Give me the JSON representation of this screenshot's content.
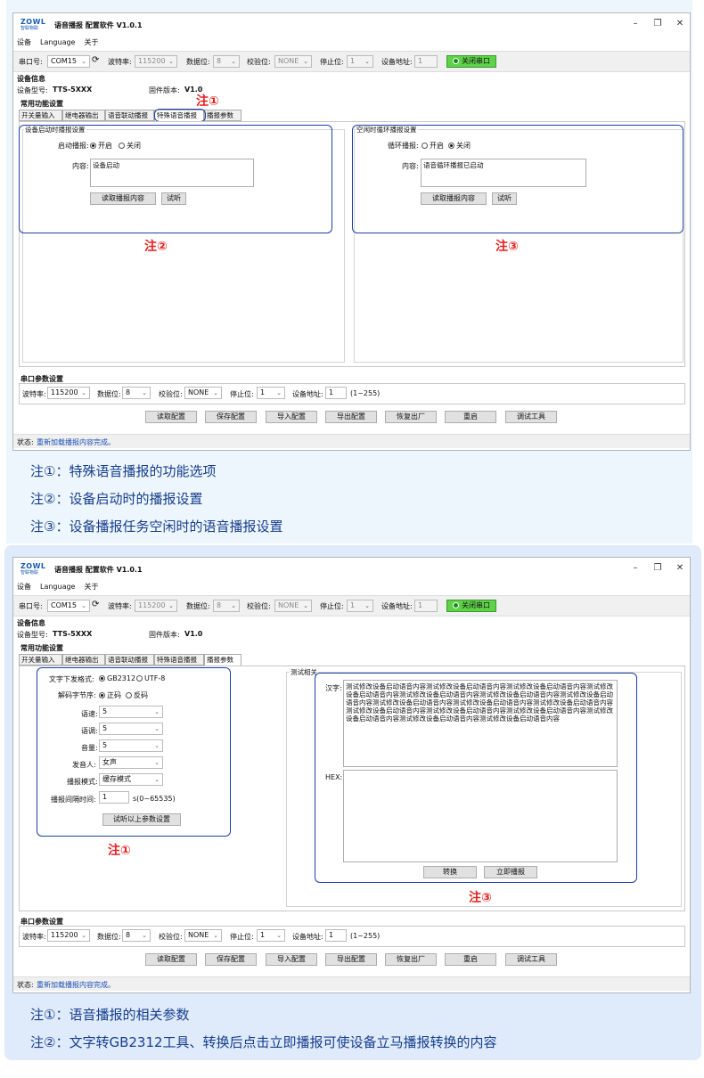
{
  "app": {
    "logo_top": "ZOWL",
    "logo_bottom": "智联物联",
    "title": "语音播报 配置软件 V1.0.1",
    "window_controls": [
      "–",
      "❐",
      "✕"
    ],
    "menu": [
      "设备",
      "Language",
      "关于"
    ]
  },
  "toolbar": {
    "port_label": "串口号:",
    "port_value": "COM15",
    "baud_label": "波特率:",
    "baud_value": "115200",
    "databits_label": "数据位:",
    "databits_value": "8",
    "parity_label": "校验位:",
    "parity_value": "NONE",
    "stopbits_label": "停止位:",
    "stopbits_value": "1",
    "addr_label": "设备地址:",
    "addr_value": "1",
    "close_port_label": "关闭串口"
  },
  "device_info": {
    "section": "设备信息",
    "model_label": "设备型号:",
    "model_value": "TTS-5XXX",
    "fw_label": "固件版本:",
    "fw_value": "V1.0"
  },
  "common": {
    "section": "常用功能设置",
    "tabs": [
      "开关量输入",
      "继电器输出",
      "语音联动播报",
      "特殊语音播报",
      "播报参数"
    ]
  },
  "special_tab": {
    "startup_group": "设备启动时播报设置",
    "startup_label": "启动播报:",
    "opt_on": "开启",
    "opt_off": "关闭",
    "content_label": "内容:",
    "startup_content": "设备启动",
    "read_btn": "读取播报内容",
    "listen_btn": "试听",
    "idle_group": "空闲时循环播报设置",
    "loop_label": "循环播报:",
    "idle_content": "语音循环播报已启动"
  },
  "notes_top": {
    "n1": "注①",
    "n2": "注②",
    "n3": "注③"
  },
  "serial_params": {
    "section": "串口参数设置",
    "baud_label": "波特率:",
    "baud_value": "115200",
    "databits_label": "数据位:",
    "databits_value": "8",
    "parity_label": "校验位:",
    "parity_value": "NONE",
    "stopbits_label": "停止位:",
    "stopbits_value": "1",
    "addr_label": "设备地址:",
    "addr_value": "1",
    "addr_hint": "(1~255)"
  },
  "actions": [
    "读取配置",
    "保存配置",
    "导入配置",
    "导出配置",
    "恢复出厂",
    "重启",
    "调试工具"
  ],
  "status": {
    "label": "状态:",
    "text": "重新加载播报内容完成。"
  },
  "captions_top": [
    "注①：特殊语音播报的功能选项",
    "注②：设备启动时的播报设置",
    "注③：设备播报任务空闲时的语音播报设置"
  ],
  "param_tab": {
    "encoding_label": "文字下发格式:",
    "enc_gb": "GB2312",
    "enc_utf": "UTF-8",
    "byteorder_label": "解码字节序:",
    "bo_pos": "正码",
    "bo_rev": "反码",
    "speed_label": "语速:",
    "speed_value": "5",
    "pitch_label": "语调:",
    "pitch_value": "5",
    "volume_label": "音量:",
    "volume_value": "5",
    "speaker_label": "发音人:",
    "speaker_value": "女声",
    "mode_label": "播报模式:",
    "mode_value": "缓存模式",
    "interval_label": "播报间隔时间:",
    "interval_value": "1",
    "interval_unit": "s(0~65535)",
    "test_btn": "试听以上参数设置",
    "test_group": "测试相关",
    "hanzi_label": "汉字:",
    "hanzi_text": "测试修改设备启动语音内容测试修改设备启动语音内容测试修改设备启动语音内容测试修改设备启动语音内容测试修改设备启动语音内容测试修改设备启动语音内容测试修改设备启动语音内容测试修改设备启动语音内容测试修改设备启动语音内容测试修改设备启动语音内容测试修改设备启动语音内容测试修改设备启动语音内容测试修改设备启动语音内容测试修改设备启动语音内容测试修改设备启动语音内容测试修改设备启动语音内容",
    "hex_label": "HEX:",
    "convert_btn": "转换",
    "play_btn": "立即播报"
  },
  "notes_bottom": {
    "n1": "注①",
    "n3": "注③"
  },
  "captions_bottom": [
    "注①：语音播报的相关参数",
    "注②：文字转GB2312工具、转换后点击立即播报可使设备立马播报转换的内容"
  ]
}
